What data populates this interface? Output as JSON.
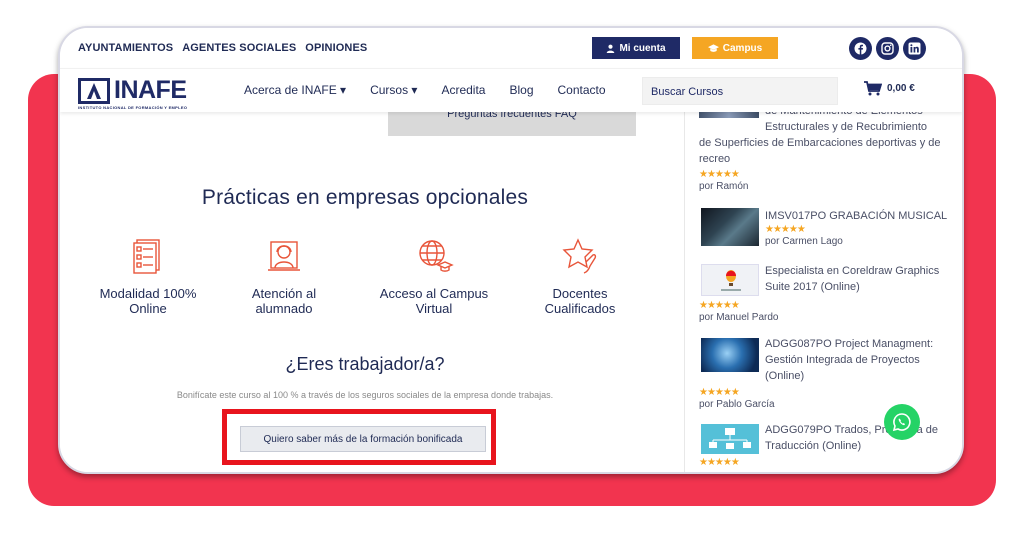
{
  "topbar": {
    "links": [
      "AYUNTAMIENTOS",
      "AGENTES SOCIALES",
      "OPINIONES"
    ],
    "account_label": "Mi cuenta",
    "campus_label": "Campus"
  },
  "social_icons": [
    "facebook-icon",
    "instagram-icon",
    "linkedin-icon"
  ],
  "logo": {
    "name": "INAFE",
    "subtitle": "INSTITUTO NACIONAL DE FORMACIÓN Y EMPLEO"
  },
  "nav": {
    "items": [
      "Acerca de INAFE ▾",
      "Cursos ▾",
      "Acredita",
      "Blog",
      "Contacto"
    ],
    "search_placeholder": "Buscar Cursos",
    "cart_total": "0,00 €"
  },
  "main": {
    "faq_label": "Preguntas frecuentes FAQ",
    "practicas_title": "Prácticas en empresas opcionales",
    "features": [
      {
        "label": "Modalidad 100% Online",
        "icon": "document-list-icon"
      },
      {
        "label": "Atención al alumnado",
        "icon": "support-agent-icon"
      },
      {
        "label": "Acceso al Campus Virtual",
        "icon": "globe-graduation-icon"
      },
      {
        "label": "Docentes Cualificados",
        "icon": "star-hand-icon"
      }
    ],
    "trabajador_title": "¿Eres trabajador/a?",
    "bonificate_text": "Bonifícate este curso al 100 % a través de los seguros sociales de la empresa donde trabajas.",
    "cta_label": "Quiero saber más de la formación bonificada"
  },
  "sidebar": {
    "products": [
      {
        "title_lines": [
          "de Mantenimiento de Elementos",
          "Estructurales y de Recubrimiento",
          "de Superficies de Embarcaciones deportivas y de",
          "recreo"
        ],
        "stars": "★★★★★",
        "author": "por Ramón"
      },
      {
        "title_lines": [
          "IMSV017PO GRABACIÓN MUSICAL"
        ],
        "stars": "★★★★★",
        "author": "por Carmen Lago"
      },
      {
        "title_lines": [
          "Especialista en Coreldraw Graphics",
          "Suite 2017 (Online)"
        ],
        "stars": "★★★★★",
        "author": "por Manuel Pardo"
      },
      {
        "title_lines": [
          "ADGG087PO Project Managment:",
          "Gestión Integrada de Proyectos",
          "(Online)"
        ],
        "stars": "★★★★★",
        "author": "por Pablo García"
      },
      {
        "title_lines": [
          "ADGG079PO Trados, Programa de",
          "Traducción (Online)"
        ],
        "stars": "★★★★★",
        "author": ""
      }
    ]
  },
  "colors": {
    "brand_navy": "#1f2a66",
    "campus_orange": "#f5a623",
    "accent_red": "#e8141d",
    "background_pink": "#f2344f",
    "whatsapp_green": "#25d366"
  }
}
